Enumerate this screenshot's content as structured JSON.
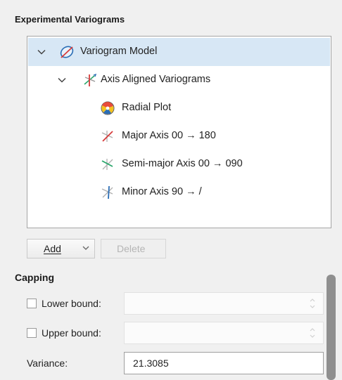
{
  "section": {
    "title": "Experimental Variograms"
  },
  "tree": {
    "items": [
      {
        "label": "Variogram Model",
        "icon": "variogram-model-icon",
        "selected": true
      },
      {
        "label": "Axis Aligned Variograms",
        "icon": "axis-aligned-variograms-icon"
      },
      {
        "label": "Radial Plot",
        "icon": "radial-plot-icon"
      },
      {
        "label": "Major Axis 00 → 180",
        "icon": "major-axis-icon"
      },
      {
        "label": "Semi-major Axis 00 → 090",
        "icon": "semi-major-axis-icon"
      },
      {
        "label": "Minor Axis 90 → /",
        "icon": "minor-axis-icon"
      }
    ]
  },
  "buttons": {
    "add_label": "Add",
    "delete_label": "Delete"
  },
  "capping": {
    "title": "Capping",
    "lower_label": "Lower bound:",
    "upper_label": "Upper bound:",
    "variance_label": "Variance:",
    "variance_value": "21.3085"
  },
  "colors": {
    "selection": "#d7e7f5",
    "accent": "#2a6db5"
  }
}
